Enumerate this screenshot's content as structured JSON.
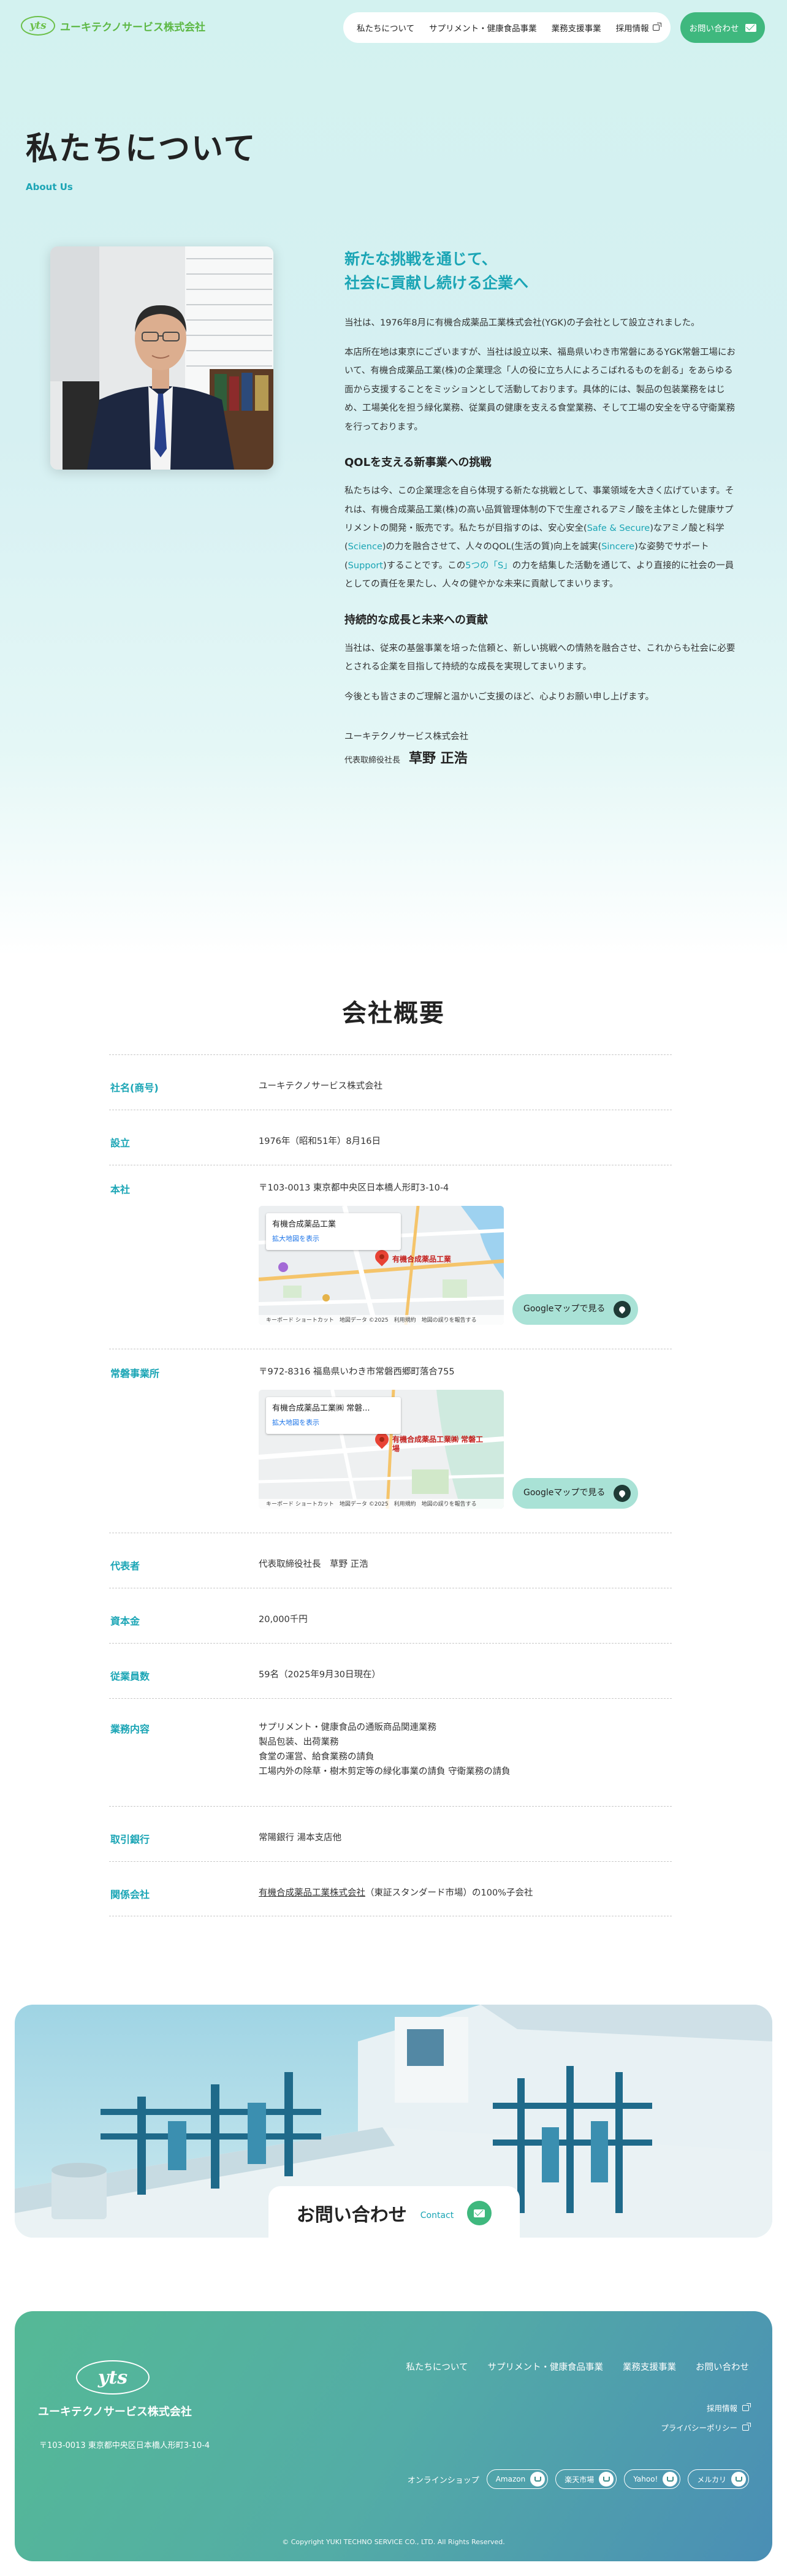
{
  "header": {
    "logo_mark": "yts",
    "company": "ユーキテクノサービス株式会社",
    "nav": [
      {
        "label": "私たちについて"
      },
      {
        "label": "サプリメント・健康食品事業"
      },
      {
        "label": "業務支援事業"
      },
      {
        "label": "採用情報"
      }
    ],
    "contact": "お問い合わせ"
  },
  "hero": {
    "title": "私たちについて",
    "subtitle": "About Us"
  },
  "message": {
    "headline_1": "新たな挑戦を通じて、",
    "headline_2": "社会に貢献し続ける企業へ",
    "p1": "当社は、1976年8月に有機合成薬品工業株式会社(YGK)の子会社として設立されました。",
    "p2": "本店所在地は東京にございますが、当社は設立以来、福島県いわき市常磐にあるYGK常磐工場において、有機合成薬品工業(株)の企業理念「人の役に立ち人によろこばれるものを創る」をあらゆる面から支援することをミッションとして活動しております。具体的には、製品の包装業務をはじめ、工場美化を担う緑化業務、従業員の健康を支える食堂業務、そして工場の安全を守る守衛業務を行っております。",
    "h_a": "QOLを支える新事業への挑戦",
    "p3_a": "私たちは今、この企業理念を自ら体現する新たな挑戦として、事業領域を大きく広げています。それは、有機合成薬品工業(株)の高い品質管理体制の下で生産されるアミノ酸を主体とした健康サプリメントの開発・販売です。私たちが目指すのは、安心安全(",
    "hl_1": "Safe & Secure",
    "p3_b": ")なアミノ酸と科学(",
    "hl_2": "Science",
    "p3_c": ")の力を融合させて、人々のQOL(生活の質)向上を誠実(",
    "hl_3": "Sincere",
    "p3_d": ")な姿勢でサポート(",
    "hl_4": "Support",
    "p3_e": ")することです。この",
    "hl_5": "5つの「S」",
    "p3_f": "の力を結集した活動を通じて、より直接的に社会の一員としての責任を果たし、人々の健やかな未来に貢献してまいります。",
    "h_b": "持続的な成長と未来への貢献",
    "p4": "当社は、従来の基盤事業を培った信頼と、新しい挑戦への情熱を融合させ、これからも社会に必要とされる企業を目指して持続的な成長を実現してまいります。",
    "p5": "今後とも皆さまのご理解と温かいご支援のほど、心よりお願い申し上げます。",
    "sign_company": "ユーキテクノサービス株式会社",
    "sign_title": "代表取締役社長",
    "sign_name": "草野 正浩"
  },
  "overview": {
    "title": "会社概要",
    "rows": [
      {
        "k": "社名(商号)",
        "v": "ユーキテクノサービス株式会社"
      },
      {
        "k": "設立",
        "v": "1976年（昭和51年）8月16日"
      },
      {
        "k": "本社",
        "v": "〒103-0013 東京都中央区日本橋人形町3-10-4"
      },
      {
        "k": "常磐事業所",
        "v": "〒972-8316 福島県いわき市常磐西郷町落合755"
      },
      {
        "k": "代表者",
        "v": "代表取締役社長　草野 正浩"
      },
      {
        "k": "資本金",
        "v": "20,000千円"
      },
      {
        "k": "従業員数",
        "v": "59名（2025年9月30日現在）"
      },
      {
        "k": "業務内容",
        "v1": "サプリメント・健康食品の通販商品関連業務",
        "v2": "製品包装、出荷業務",
        "v3": "食堂の運営、給食業務の請負",
        "v4": "工場内外の除草・樹木剪定等の緑化事業の請負 守衛業務の請負"
      },
      {
        "k": "取引銀行",
        "v": "常陽銀行 湯本支店他"
      },
      {
        "k": "関係会社",
        "link": "有機合成薬品工業株式会社",
        "v": "（東証スタンダード市場）の100%子会社"
      }
    ],
    "map1": {
      "title": "有機合成薬品工業",
      "link": "拡大地図を表示",
      "pin": "有機合成薬品工業",
      "foot": "キーボード ショートカット　地図データ ©2025　利用規約　地図の誤りを報告する"
    },
    "map2": {
      "title": "有機合成薬品工業㈱ 常磐...",
      "link": "拡大地図を表示",
      "pin": "有機合成薬品工業㈱ 常磐工場",
      "foot": "キーボード ショートカット　地図データ ©2025　利用規約　地図の誤りを報告する"
    },
    "gmap_label": "Googleマップで見る"
  },
  "banner": {
    "ja": "お問い合わせ",
    "en": "Contact"
  },
  "footer": {
    "logo_mark": "yts",
    "company": "ユーキテクノサービス株式会社",
    "address": "〒103-0013 東京都中央区日本橋人形町3-10-4",
    "nav": [
      "私たちについて",
      "サプリメント・健康食品事業",
      "業務支援事業",
      "お問い合わせ"
    ],
    "recruit": "採用情報",
    "privacy": "プライバシーポリシー",
    "shop_label": "オンラインショップ",
    "shops": [
      "Amazon",
      "楽天市場",
      "Yahoo!",
      "メルカリ"
    ],
    "copyright": "© Copyright YUKI TECHNO SERVICE CO., LTD. All Rights Reserved."
  },
  "colors": {
    "accent": "#1aa5b5",
    "brand_green": "#3fb87e",
    "logo_green": "#5db845"
  }
}
